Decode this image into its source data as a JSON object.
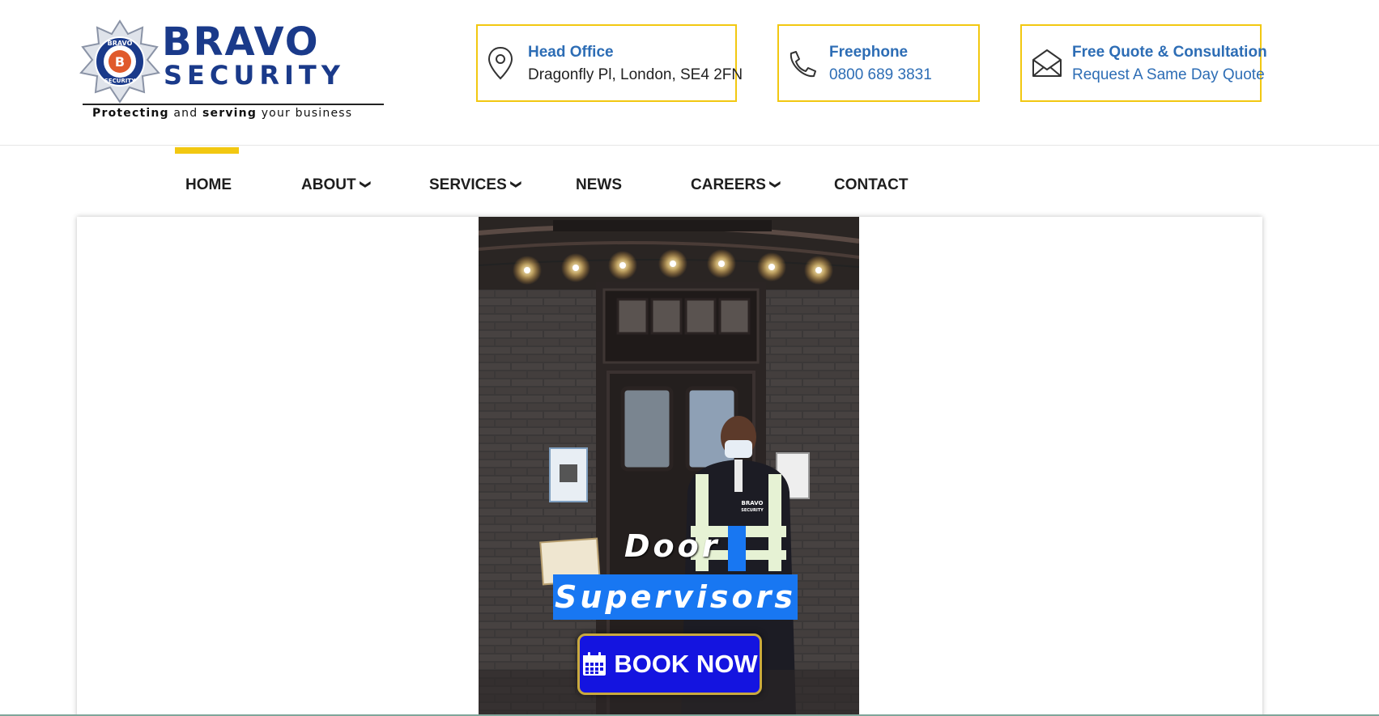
{
  "logo": {
    "title": "BRAVO",
    "subtitle": "SECURITY",
    "tagline_part1": "Protecting",
    "tagline_part2": " and ",
    "tagline_part3": "serving",
    "tagline_part4": " your business",
    "badge_top": "BRAVO",
    "badge_bottom": "SECURITY",
    "badge_letter": "B"
  },
  "contacts": [
    {
      "icon": "location-pin-icon",
      "title": "Head Office",
      "detail": "Dragonfly Pl, London, SE4 2FN"
    },
    {
      "icon": "phone-icon",
      "title": "Freephone",
      "detail": "0800 689 3831"
    },
    {
      "icon": "envelope-icon",
      "title": "Free Quote & Consultation",
      "detail": "Request A Same Day Quote"
    }
  ],
  "nav": {
    "items": [
      {
        "label": "HOME",
        "active": true
      },
      {
        "label": "ABOUT",
        "dropdown": true
      },
      {
        "label": "SERVICES",
        "dropdown": true
      },
      {
        "label": "NEWS"
      },
      {
        "label": "CAREERS",
        "dropdown": true
      },
      {
        "label": "CONTACT"
      }
    ],
    "chevron": "❯"
  },
  "hero": {
    "caption_line1": "Door",
    "caption_line2": "Supervisors",
    "vest_text_1": "BRAVO",
    "vest_text_2": "SECURITY",
    "book_button": "BOOK NOW",
    "book_icon": "calendar-icon"
  },
  "colors": {
    "accent_yellow": "#f2c811",
    "brand_blue": "#1a3a8a",
    "link_blue": "#2d6db5",
    "caption_highlight": "#1877f2",
    "button_blue": "#1414e0"
  }
}
